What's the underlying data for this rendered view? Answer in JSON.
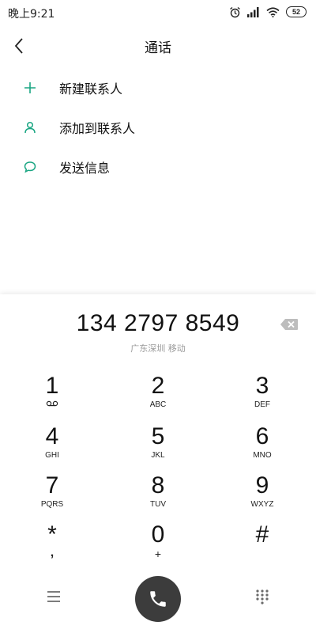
{
  "status_bar": {
    "time": "晚上9:21",
    "battery": "52"
  },
  "header": {
    "title": "通话"
  },
  "menu": {
    "items": [
      {
        "label": "新建联系人",
        "icon": "plus-icon"
      },
      {
        "label": "添加到联系人",
        "icon": "person-icon"
      },
      {
        "label": "发送信息",
        "icon": "message-icon"
      }
    ]
  },
  "dialer": {
    "number": "134 2797 8549",
    "location": "广东深圳 移动",
    "keys": [
      {
        "digit": "1",
        "letters": ""
      },
      {
        "digit": "2",
        "letters": "ABC"
      },
      {
        "digit": "3",
        "letters": "DEF"
      },
      {
        "digit": "4",
        "letters": "GHI"
      },
      {
        "digit": "5",
        "letters": "JKL"
      },
      {
        "digit": "6",
        "letters": "MNO"
      },
      {
        "digit": "7",
        "letters": "PQRS"
      },
      {
        "digit": "8",
        "letters": "TUV"
      },
      {
        "digit": "9",
        "letters": "WXYZ"
      },
      {
        "digit": "*",
        "letters": ","
      },
      {
        "digit": "0",
        "letters": "+"
      },
      {
        "digit": "#",
        "letters": ""
      }
    ]
  },
  "colors": {
    "accent": "#1aa683",
    "call_button": "#3c3c3c"
  }
}
